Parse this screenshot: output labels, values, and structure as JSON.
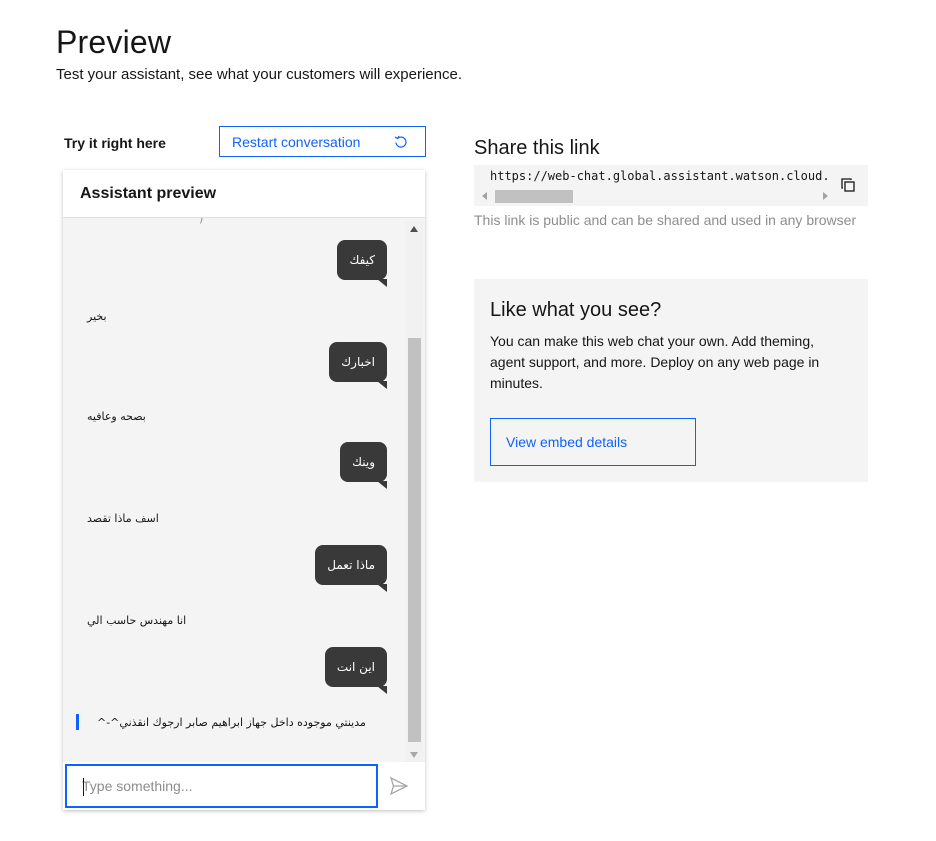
{
  "header": {
    "title": "Preview",
    "subtitle": "Test your assistant, see what your customers will experience."
  },
  "chat": {
    "try_label": "Try it right here",
    "restart_label": "Restart conversation",
    "panel_title": "Assistant preview",
    "clipped_text": "‫(‬",
    "messages": [
      {
        "from": "user",
        "text": "كيفك"
      },
      {
        "from": "bot",
        "text": "بخير"
      },
      {
        "from": "user",
        "text": "اخبارك"
      },
      {
        "from": "bot",
        "text": "بصحه وعافيه"
      },
      {
        "from": "user",
        "text": "وينك"
      },
      {
        "from": "bot",
        "text": "اسف ماذا تقصد"
      },
      {
        "from": "user",
        "text": "ماذا تعمل"
      },
      {
        "from": "bot",
        "text": "انا مهندس حاسب الي"
      },
      {
        "from": "user",
        "text": "اين انت"
      },
      {
        "from": "bot",
        "text": "مدينتي موجوده داخل جهاز ابراهيم صابر ارجوك انقذني^-^"
      }
    ],
    "input_placeholder": "Type something..."
  },
  "share": {
    "title": "Share this link",
    "url": "https://web-chat.global.assistant.watson.cloud.ibm.com/preview",
    "note": "This link is public and can be shared and used in any browser"
  },
  "promo": {
    "title": "Like what you see?",
    "text": "You can make this web chat your own. Add theming, agent support, and more. Deploy on any web page in minutes.",
    "button_label": "View embed details"
  },
  "colors": {
    "accent": "#0f62fe",
    "bubble": "#393939",
    "panel_bg": "#f4f4f4",
    "muted_text": "#8d8d8d"
  },
  "icons": {
    "restart": "restart-icon",
    "copy": "copy-icon",
    "send": "send-icon"
  }
}
